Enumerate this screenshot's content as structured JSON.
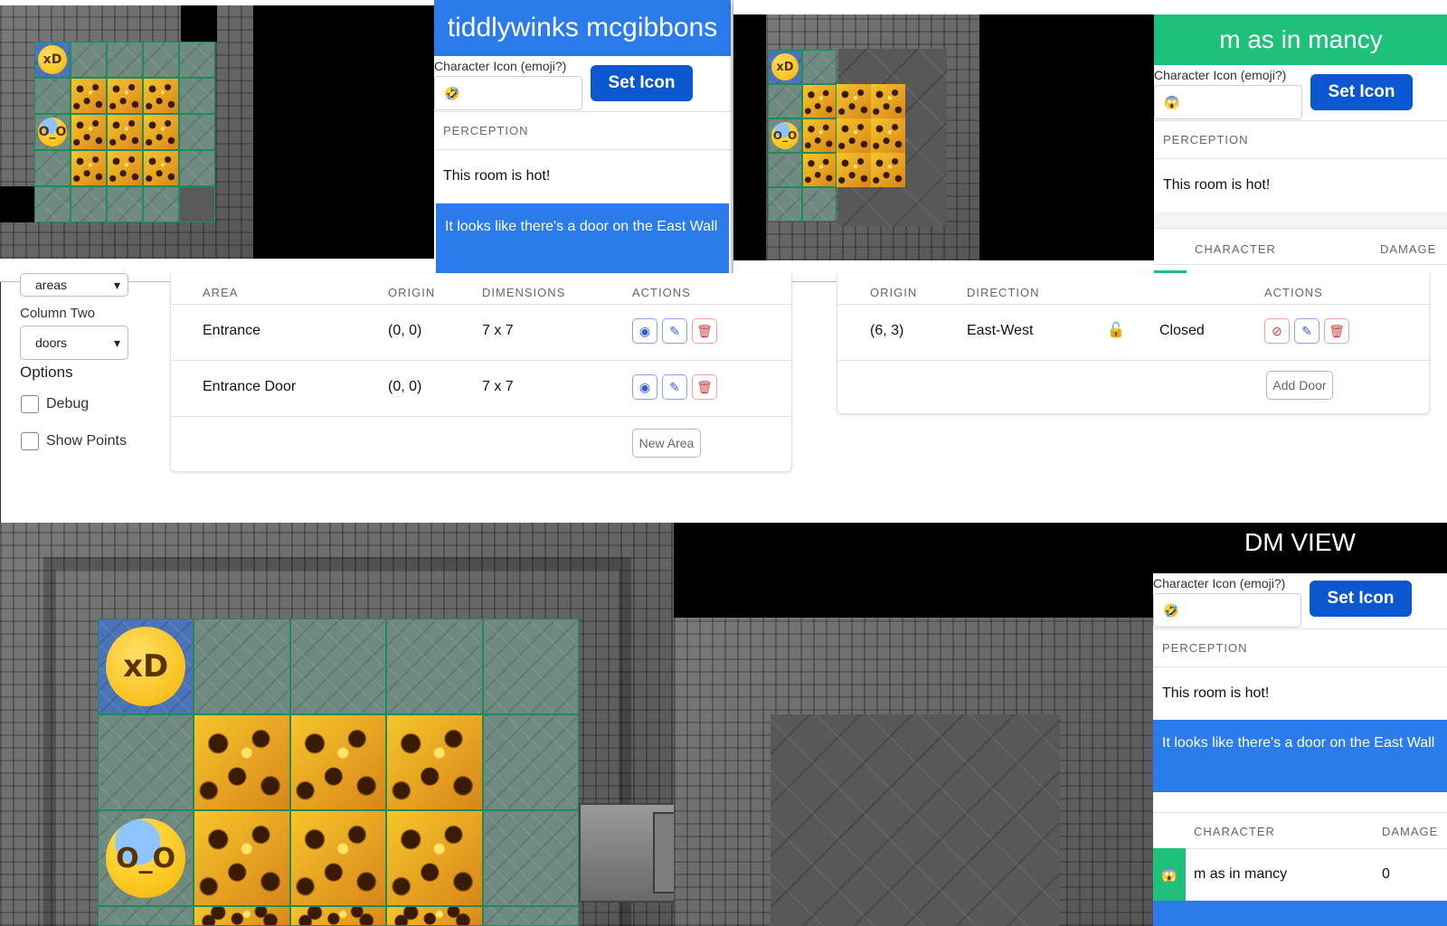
{
  "player_panel_1": {
    "title": "tiddlywinks mcgibbons",
    "title_color": "#2b7bea",
    "icon_label": "Character Icon (emoji?)",
    "icon_value": "🤣",
    "set_icon_label": "Set Icon",
    "perception_header": "PERCEPTION",
    "perception_text": "This room is hot!",
    "door_message": "It looks like there's a door on the East Wall"
  },
  "player_panel_2": {
    "title": "m as in mancy",
    "title_color": "#1ec07a",
    "icon_label": "Character Icon (emoji?)",
    "icon_value": "😱",
    "set_icon_label": "Set Icon",
    "perception_header": "PERCEPTION",
    "perception_text": "This room is hot!",
    "character_header": "CHARACTER",
    "damage_header": "DAMAGE"
  },
  "sidebar": {
    "column_one_value": "areas",
    "column_two_label": "Column Two",
    "column_two_value": "doors",
    "options_label": "Options",
    "debug_label": "Debug",
    "show_points_label": "Show Points"
  },
  "areas_table": {
    "headers": [
      "AREA",
      "ORIGIN",
      "DIMENSIONS",
      "ACTIONS"
    ],
    "rows": [
      {
        "area": "Entrance",
        "origin": "(0, 0)",
        "dimensions": "7 x 7"
      },
      {
        "area": "Entrance Door",
        "origin": "(0, 0)",
        "dimensions": "7 x 7"
      }
    ],
    "new_area_label": "New Area"
  },
  "doors_table": {
    "headers": [
      "ORIGIN",
      "DIRECTION",
      "ACTIONS"
    ],
    "rows": [
      {
        "origin": "(6, 3)",
        "direction": "East-West",
        "state": "Closed"
      }
    ],
    "add_door_label": "Add Door"
  },
  "dm_panel": {
    "title": "DM VIEW",
    "icon_label": "Character Icon (emoji?)",
    "icon_value": "🤣",
    "set_icon_label": "Set Icon",
    "perception_header": "PERCEPTION",
    "perception_text": "This room is hot!",
    "door_message": "It looks like there's a door on the East Wall",
    "character_header": "CHARACTER",
    "damage_header": "DAMAGE",
    "characters": [
      {
        "icon": "😱",
        "name": "m as in mancy",
        "damage": "0",
        "color": "#1ec07a"
      }
    ]
  },
  "colors": {
    "primary_button": "#0b57d0",
    "info_blue": "#2b7bea",
    "grid_line": "#1f8a5a"
  },
  "icons": [
    "eye-icon",
    "eye-off-icon",
    "edit-icon",
    "trash-icon",
    "unlock-icon",
    "chevron-down-icon"
  ]
}
